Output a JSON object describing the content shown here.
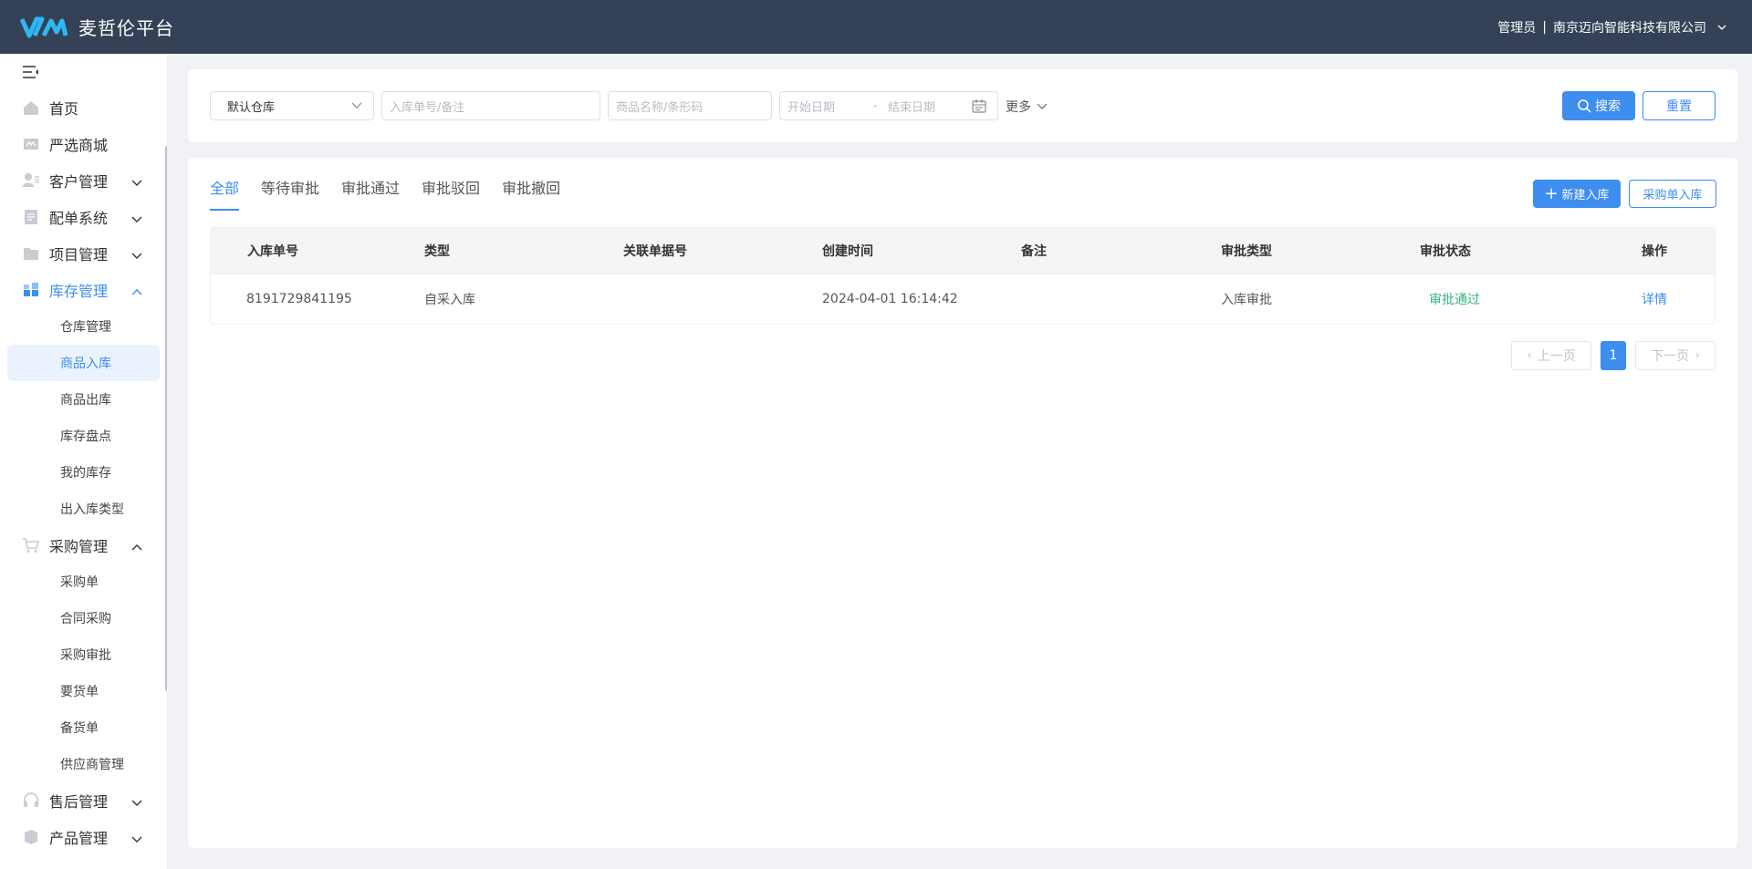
{
  "header": {
    "logo_text": "麦哲伦平台",
    "user_role": "管理员",
    "separator": "|",
    "company": "南京迈向智能科技有限公司"
  },
  "sidebar": {
    "items": [
      {
        "label": "首页",
        "icon": "home-icon"
      },
      {
        "label": "严选商城",
        "icon": "mall-icon"
      },
      {
        "label": "客户管理",
        "icon": "customer-icon",
        "expandable": true
      },
      {
        "label": "配单系统",
        "icon": "order-icon",
        "expandable": true
      },
      {
        "label": "项目管理",
        "icon": "folder-icon",
        "expandable": true
      },
      {
        "label": "库存管理",
        "icon": "inventory-icon",
        "expanded": true,
        "active": true,
        "children": [
          "仓库管理",
          "商品入库",
          "商品出库",
          "库存盘点",
          "我的库存",
          "出入库类型"
        ]
      },
      {
        "label": "采购管理",
        "icon": "cart-icon",
        "expanded": true,
        "children": [
          "采购单",
          "合同采购",
          "采购审批",
          "要货单",
          "备货单",
          "供应商管理"
        ]
      },
      {
        "label": "售后管理",
        "icon": "headset-icon",
        "expandable": true
      },
      {
        "label": "产品管理",
        "icon": "product-icon",
        "expandable": true
      }
    ],
    "active_sub": "商品入库"
  },
  "filters": {
    "warehouse_value": "默认仓库",
    "order_placeholder": "入库单号/备注",
    "goods_placeholder": "商品名称/条形码",
    "date_start_placeholder": "开始日期",
    "date_separator": "-",
    "date_end_placeholder": "结束日期",
    "more_label": "更多",
    "search_label": "搜索",
    "reset_label": "重置"
  },
  "tabs": [
    "全部",
    "等待审批",
    "审批通过",
    "审批驳回",
    "审批撤回"
  ],
  "actions": {
    "new_label": "新建入库",
    "po_label": "采购单入库"
  },
  "table": {
    "columns": [
      "入库单号",
      "类型",
      "关联单据号",
      "创建时间",
      "备注",
      "审批类型",
      "审批状态",
      "操作"
    ],
    "rows": [
      {
        "order_no": "8191729841195",
        "type": "自采入库",
        "related_no": "",
        "created": "2024-04-01 16:14:42",
        "remark": "",
        "approval_type": "入库审批",
        "status": "审批通过",
        "action": "详情"
      }
    ]
  },
  "pager": {
    "prev_label": "上一页",
    "page": "1",
    "next_label": "下一页"
  },
  "colors": {
    "header_bg": "#344156",
    "accent": "#3d8eef",
    "success": "#36b37e"
  }
}
